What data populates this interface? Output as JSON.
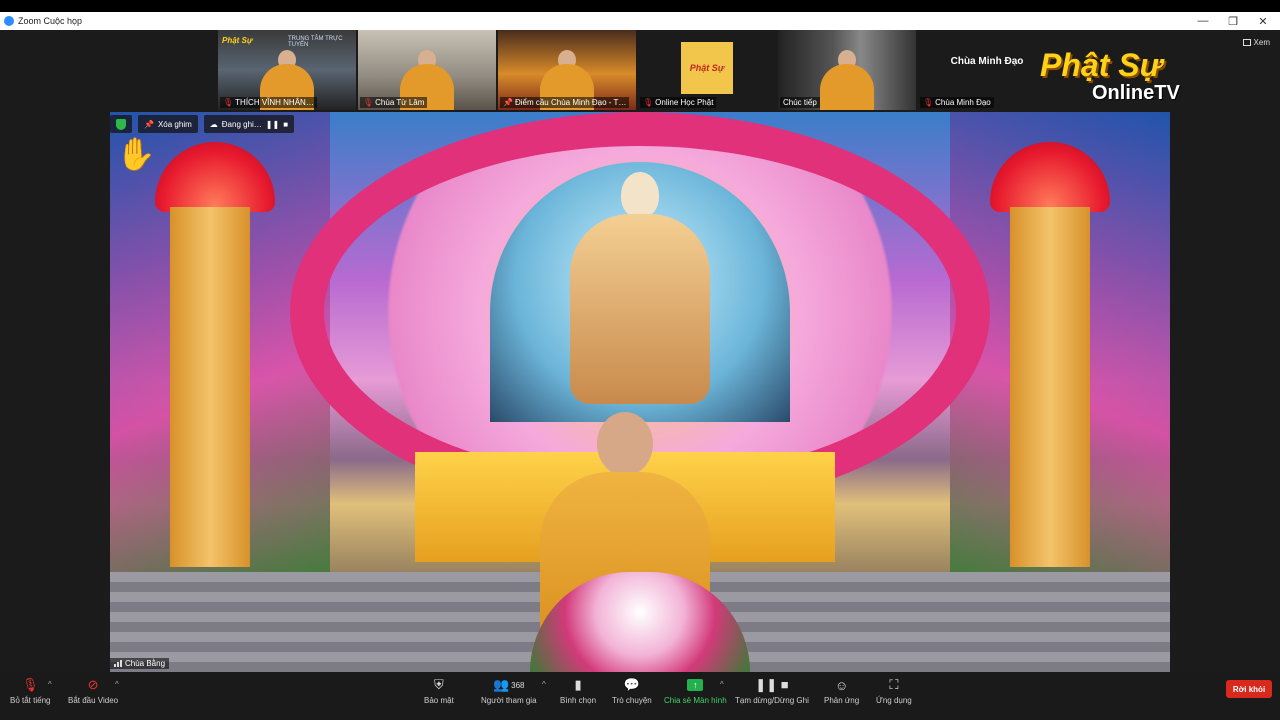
{
  "window": {
    "title": "Zoom Cuộc họp",
    "minimize": "—",
    "restore": "❐",
    "close": "✕"
  },
  "thumbnails": [
    {
      "label": "THÍCH VĨNH NHÂN…",
      "banner": "TRUNG TÂM TRỰC TUYẾN",
      "logo_text": "Phật Sự",
      "muted": true
    },
    {
      "label": "Chùa Từ Lâm",
      "muted": true
    },
    {
      "label": "Điểm cầu Chùa Minh Đạo - T…",
      "muted": false
    },
    {
      "label": "Online Học Phật",
      "logo_text": "Phật Sự",
      "muted": true
    },
    {
      "label": "Chúc tiếp",
      "muted": false
    },
    {
      "label": "Chùa Minh Đạo",
      "center_name": "Chùa Minh Đạo",
      "muted": true
    }
  ],
  "brand": {
    "line1": "Phật Sự",
    "line2": "OnlineTV"
  },
  "view_button": "Xem",
  "overlay": {
    "unpin": "Xóa ghim",
    "recording": "Đang ghi…",
    "pause": "❚❚",
    "stop": "■"
  },
  "main_video_label": "Chùa Bằng",
  "raise_hand": "✋",
  "toolbar": {
    "mute": "Bỏ tắt tiếng",
    "video": "Bắt đầu Video",
    "security": "Bảo mật",
    "participants": "Người tham gia",
    "participants_count": "368",
    "polls": "Bình chọn",
    "chat": "Trò chuyện",
    "share": "Chia sẻ Màn hình",
    "record": "Tạm dừng/Dừng Ghi",
    "reactions": "Phản ứng",
    "apps": "Ứng dụng",
    "leave": "Rời khỏi"
  },
  "colors": {
    "share_green": "#23b14d",
    "leave_red": "#d8291f",
    "shield_green": "#2fb84a"
  }
}
